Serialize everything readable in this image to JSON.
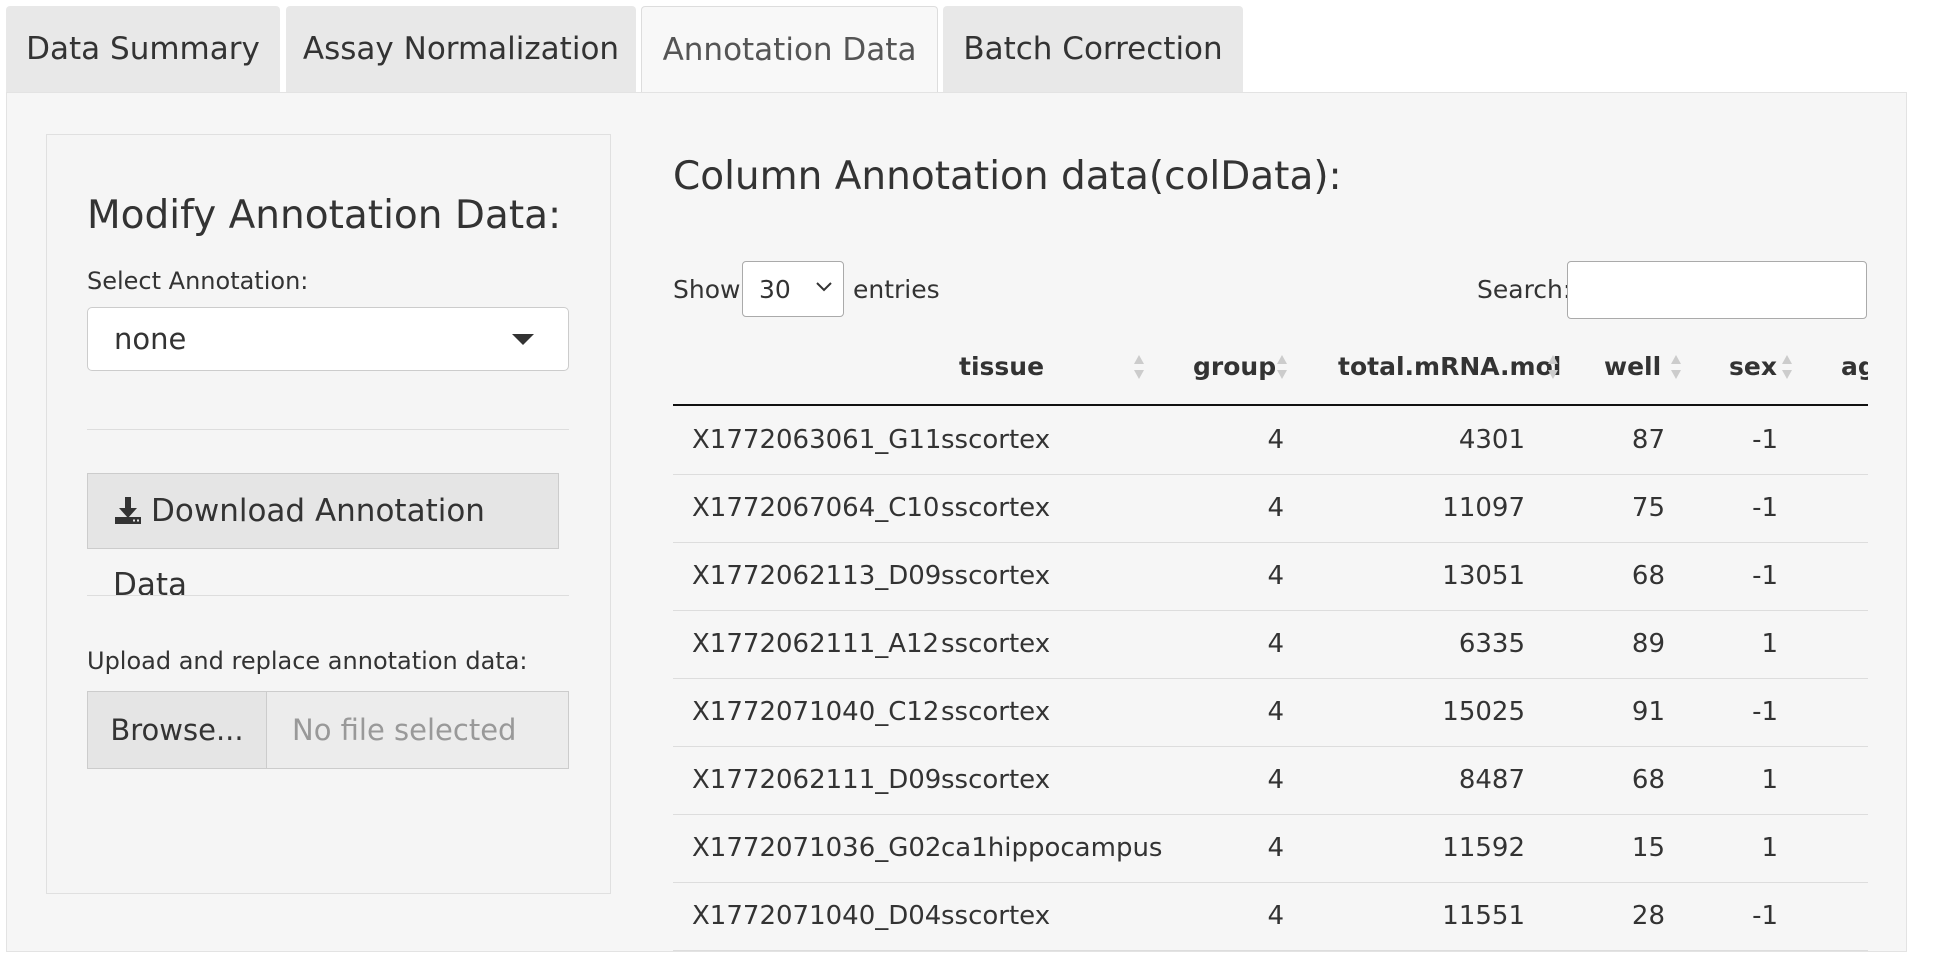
{
  "tabs": [
    {
      "label": "Data Summary",
      "active": false
    },
    {
      "label": "Assay Normalization",
      "active": false
    },
    {
      "label": "Annotation Data",
      "active": true
    },
    {
      "label": "Batch Correction",
      "active": false
    }
  ],
  "sidebar": {
    "title": "Modify Annotation Data:",
    "select_label": "Select Annotation:",
    "select_value": "none",
    "download_label": "Download Annotation Data",
    "upload_label": "Upload and replace annotation data:",
    "browse_label": "Browse...",
    "file_placeholder": "No file selected"
  },
  "main": {
    "title": "Column Annotation data(colData):",
    "show_label": "Show",
    "entries_value": "30",
    "entries_label": "entries",
    "search_label": "Search:",
    "search_value": ""
  },
  "table": {
    "columns": [
      "",
      "tissue",
      "group",
      "total.mRNA.mol",
      "well",
      "sex",
      "ag"
    ],
    "rows": [
      [
        "X1772063061_G11",
        "sscortex",
        "4",
        "4301",
        "87",
        "-1"
      ],
      [
        "X1772067064_C10",
        "sscortex",
        "4",
        "11097",
        "75",
        "-1"
      ],
      [
        "X1772062113_D09",
        "sscortex",
        "4",
        "13051",
        "68",
        "-1"
      ],
      [
        "X1772062111_A12",
        "sscortex",
        "4",
        "6335",
        "89",
        "1"
      ],
      [
        "X1772071040_C12",
        "sscortex",
        "4",
        "15025",
        "91",
        "-1"
      ],
      [
        "X1772062111_D09",
        "sscortex",
        "4",
        "8487",
        "68",
        "1"
      ],
      [
        "X1772071036_G02",
        "ca1hippocampus",
        "4",
        "11592",
        "15",
        "1"
      ],
      [
        "X1772071040_D04",
        "sscortex",
        "4",
        "11551",
        "28",
        "-1"
      ]
    ]
  },
  "colors": {
    "tab_bg": "#e8e8e8",
    "panel_bg": "#f6f6f6",
    "button_bg": "#e5e5e5",
    "text": "#333333",
    "placeholder": "#999999"
  }
}
